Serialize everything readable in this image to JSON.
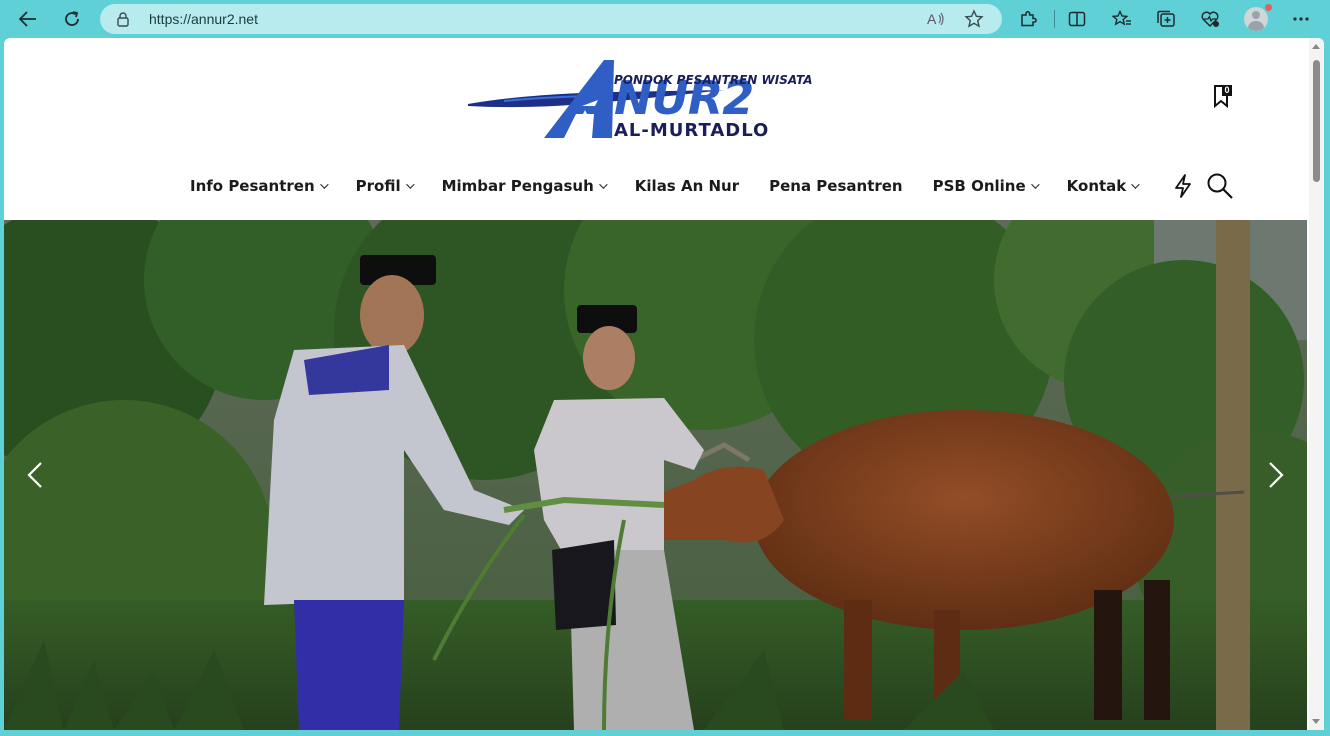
{
  "browser": {
    "url": "https://annur2.net"
  },
  "site": {
    "logo": {
      "top_text": "PONDOK PESANTREN WISATA",
      "main_text": "ANNUR2",
      "sub_text": "AL-MURTADLO"
    },
    "bookmark_count": "0",
    "nav": [
      {
        "label": "Info Pesantren",
        "dropdown": true
      },
      {
        "label": "Profil",
        "dropdown": true
      },
      {
        "label": "Mimbar Pengasuh",
        "dropdown": true
      },
      {
        "label": "Kilas An Nur",
        "dropdown": false
      },
      {
        "label": "Pena Pesantren",
        "dropdown": false
      },
      {
        "label": "PSB Online",
        "dropdown": true
      },
      {
        "label": "Kontak",
        "dropdown": true
      }
    ]
  },
  "icons": {
    "back": "back-arrow-icon",
    "refresh": "refresh-icon",
    "lock": "lock-icon",
    "read_aloud": "read-aloud-icon",
    "favorite": "star-icon",
    "extensions": "puzzle-icon",
    "split": "split-screen-icon",
    "favorites": "favorites-icon",
    "collections": "collections-icon",
    "performance": "heart-pulse-icon",
    "profile": "avatar",
    "menu": "more-icon",
    "bookmark": "bookmark-icon",
    "flash": "lightning-icon",
    "search": "search-icon",
    "prev": "chevron-left-icon",
    "next": "chevron-right-icon"
  },
  "colors": {
    "browser_frame": "#5fd0d6",
    "address_bar": "#b7ebee",
    "logo_blue": "#2f5fc4",
    "logo_dark": "#1a1f5a"
  }
}
